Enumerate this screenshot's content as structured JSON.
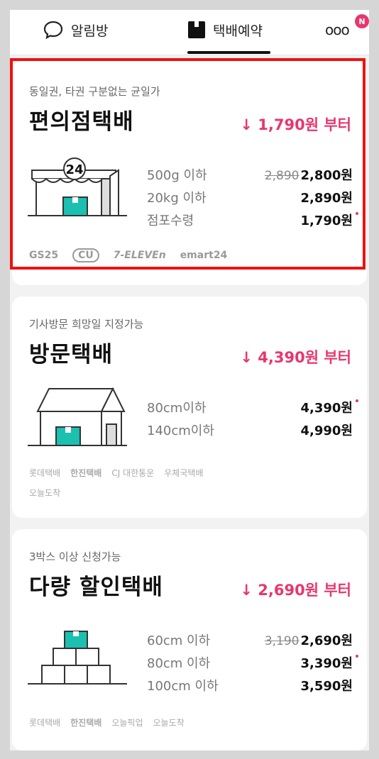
{
  "tabs": {
    "notice": "알림방",
    "delivery": "택배예약",
    "more": "ooo",
    "badge": "N"
  },
  "colors": {
    "accent": "#e7376f",
    "highlight": "#ee1111",
    "box": "#1bc0b0"
  },
  "cards": [
    {
      "subtitle": "동일권, 타권 구분없는 균일가",
      "title": "편의점택배",
      "from_price": "↓ 1,790원 부터",
      "rows": [
        {
          "label": "500g 이하",
          "old": "2,890",
          "price": "2,800원"
        },
        {
          "label": "20kg 이하",
          "price": "2,890원"
        },
        {
          "label": "점포수령",
          "price": "1,790원"
        }
      ],
      "logos": [
        "GS25",
        "CU",
        "7-ELEVEn",
        "emart24"
      ],
      "store_number": "24"
    },
    {
      "subtitle": "기사방문 희망일 지정가능",
      "title": "방문택배",
      "from_price": "↓ 4,390원 부터",
      "rows": [
        {
          "label": "80cm이하",
          "price": "4,390원"
        },
        {
          "label": "140cm이하",
          "price": "4,990원"
        }
      ],
      "logos": [
        "롯데택배",
        "한진택배",
        "CJ 대한통운",
        "우체국택배",
        "오늘도착"
      ]
    },
    {
      "subtitle": "3박스 이상 신청가능",
      "title": "다량 할인택배",
      "from_price": "↓ 2,690원 부터",
      "rows": [
        {
          "label": "60cm 이하",
          "old": "3,190",
          "price": "2,690원"
        },
        {
          "label": "80cm 이하",
          "price": "3,390원"
        },
        {
          "label": "100cm 이하",
          "price": "3,590원"
        }
      ],
      "logos": [
        "롯데택배",
        "한진택배",
        "오늘픽업",
        "오늘도착"
      ]
    }
  ]
}
